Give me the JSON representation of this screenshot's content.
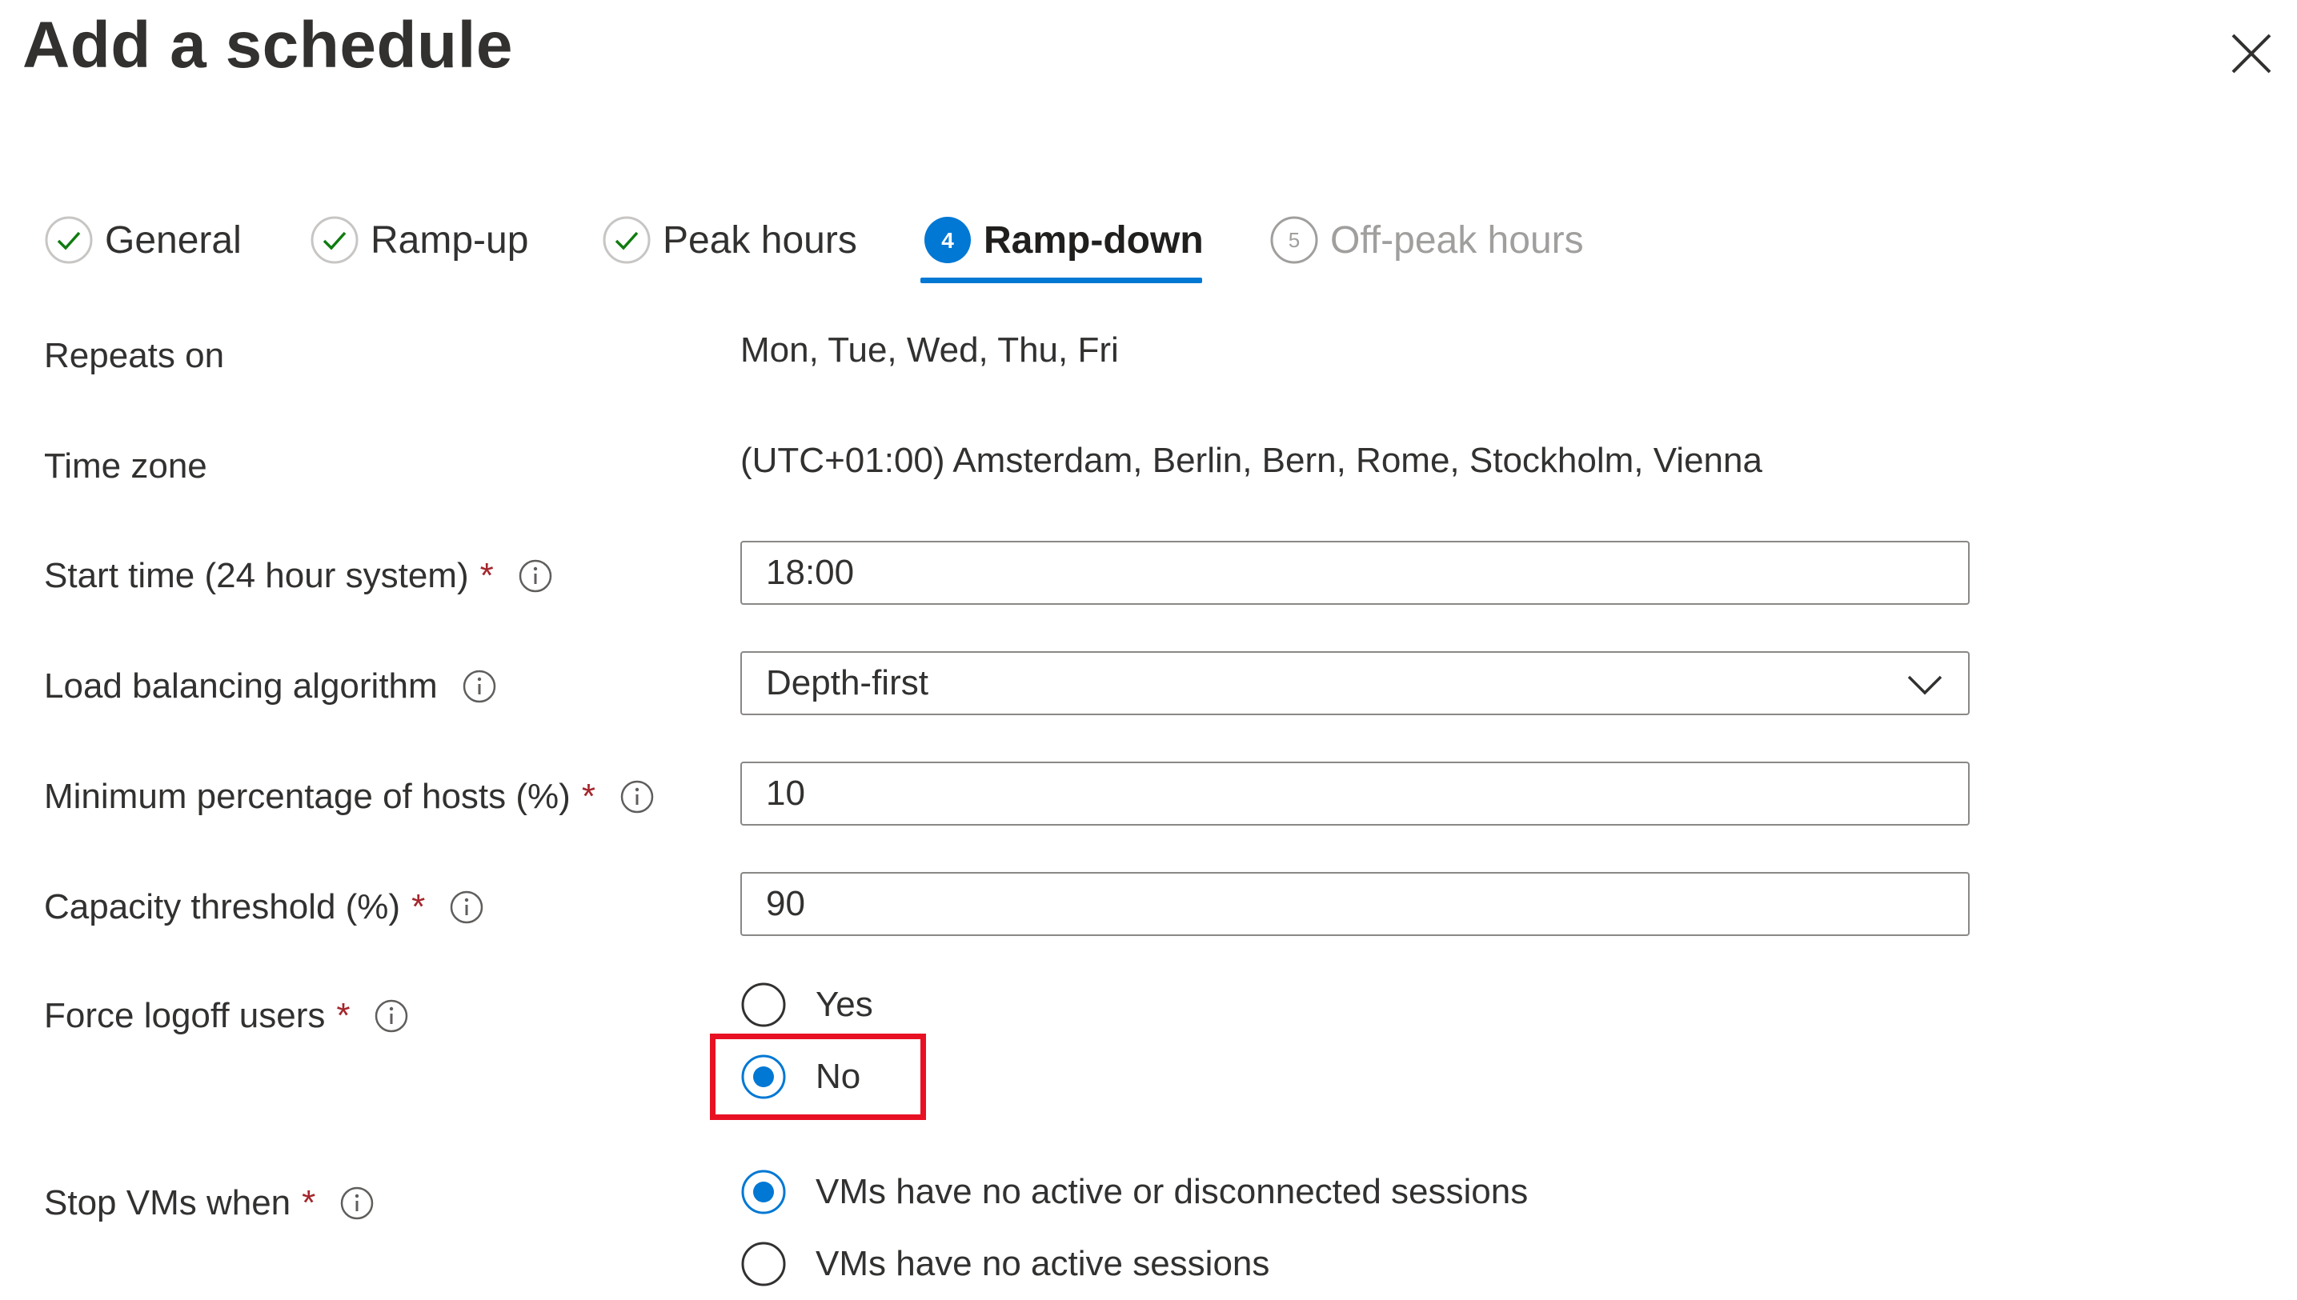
{
  "header": {
    "title": "Add a schedule",
    "close_icon": "close-icon"
  },
  "tabs": [
    {
      "label": "General",
      "state": "completed",
      "icon": "check-circle-icon"
    },
    {
      "label": "Ramp-up",
      "state": "completed",
      "icon": "check-circle-icon"
    },
    {
      "label": "Peak hours",
      "state": "completed",
      "icon": "check-circle-icon"
    },
    {
      "label": "Ramp-down",
      "state": "active",
      "step": "4",
      "icon": "step-number-icon"
    },
    {
      "label": "Off-peak hours",
      "state": "disabled",
      "step": "5",
      "icon": "step-number-icon"
    }
  ],
  "form": {
    "repeats_on": {
      "label": "Repeats on",
      "value": "Mon, Tue, Wed, Thu, Fri"
    },
    "time_zone": {
      "label": "Time zone",
      "value": "(UTC+01:00) Amsterdam, Berlin, Bern, Rome, Stockholm, Vienna"
    },
    "start_time": {
      "label": "Start time (24 hour system)",
      "required": "*",
      "value": "18:00"
    },
    "load_balancing": {
      "label": "Load balancing algorithm",
      "value": "Depth-first"
    },
    "min_hosts": {
      "label": "Minimum percentage of hosts (%)",
      "required": "*",
      "value": "10"
    },
    "capacity_threshold": {
      "label": "Capacity threshold (%)",
      "required": "*",
      "value": "90"
    },
    "force_logoff": {
      "label": "Force logoff users",
      "required": "*",
      "options": [
        {
          "label": "Yes",
          "selected": false
        },
        {
          "label": "No",
          "selected": true
        }
      ]
    },
    "stop_vms": {
      "label": "Stop VMs when",
      "required": "*",
      "options": [
        {
          "label": "VMs have no active or disconnected sessions",
          "selected": true
        },
        {
          "label": "VMs have no active sessions",
          "selected": false
        }
      ]
    }
  },
  "colors": {
    "accent": "#0078d4",
    "success": "#107c10",
    "required": "#a4262c",
    "highlight": "#e81123",
    "text": "#323130",
    "disabled": "#a19f9d"
  }
}
